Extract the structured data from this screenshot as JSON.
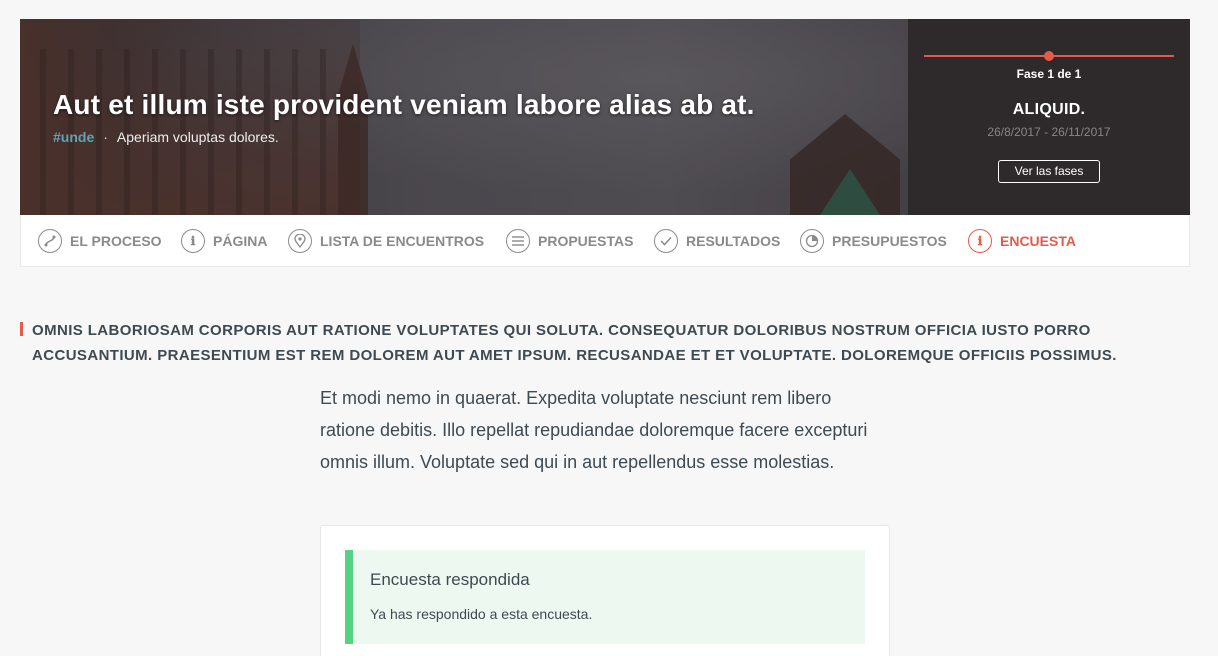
{
  "hero": {
    "title": "Aut et illum iste provident veniam labore alias ab at.",
    "hashtag": "#unde",
    "separator": "·",
    "subtitle": "Aperiam voluptas dolores."
  },
  "phase": {
    "label": "Fase 1 de 1",
    "name": "ALIQUID.",
    "dates": "26/8/2017 - 26/11/2017",
    "button_label": "Ver las fases"
  },
  "nav": {
    "items": [
      {
        "label": "EL PROCESO",
        "icon": "process-icon"
      },
      {
        "label": "PÁGINA",
        "icon": "info-icon"
      },
      {
        "label": "LISTA DE ENCUENTROS",
        "icon": "location-pin-icon"
      },
      {
        "label": "PROPUESTAS",
        "icon": "list-icon"
      },
      {
        "label": "RESULTADOS",
        "icon": "check-icon"
      },
      {
        "label": "PRESUPUESTOS",
        "icon": "pie-chart-icon"
      },
      {
        "label": "ENCUESTA",
        "icon": "info-icon",
        "active": true
      }
    ]
  },
  "content": {
    "heading": "OMNIS LABORIOSAM CORPORIS AUT RATIONE VOLUPTATES QUI SOLUTA. CONSEQUATUR DOLORIBUS NOSTRUM OFFICIA IUSTO PORRO ACCUSANTIUM. PRAESENTIUM EST REM DOLOREM AUT AMET IPSUM. RECUSANDAE ET ET VOLUPTATE. DOLOREMQUE OFFICIIS POSSIMUS.",
    "description": "Et modi nemo in quaerat. Expedita voluptate nesciunt rem libero ratione debitis. Illo repellat repudiandae doloremque facere excepturi omnis illum. Voluptate sed qui in aut repellendus esse molestias."
  },
  "callout": {
    "title": "Encuesta respondida",
    "text": "Ya has respondido a esta encuesta."
  },
  "colors": {
    "accent": "#e65a4a",
    "success": "#57d283",
    "hashtag": "#5fa3b4"
  }
}
